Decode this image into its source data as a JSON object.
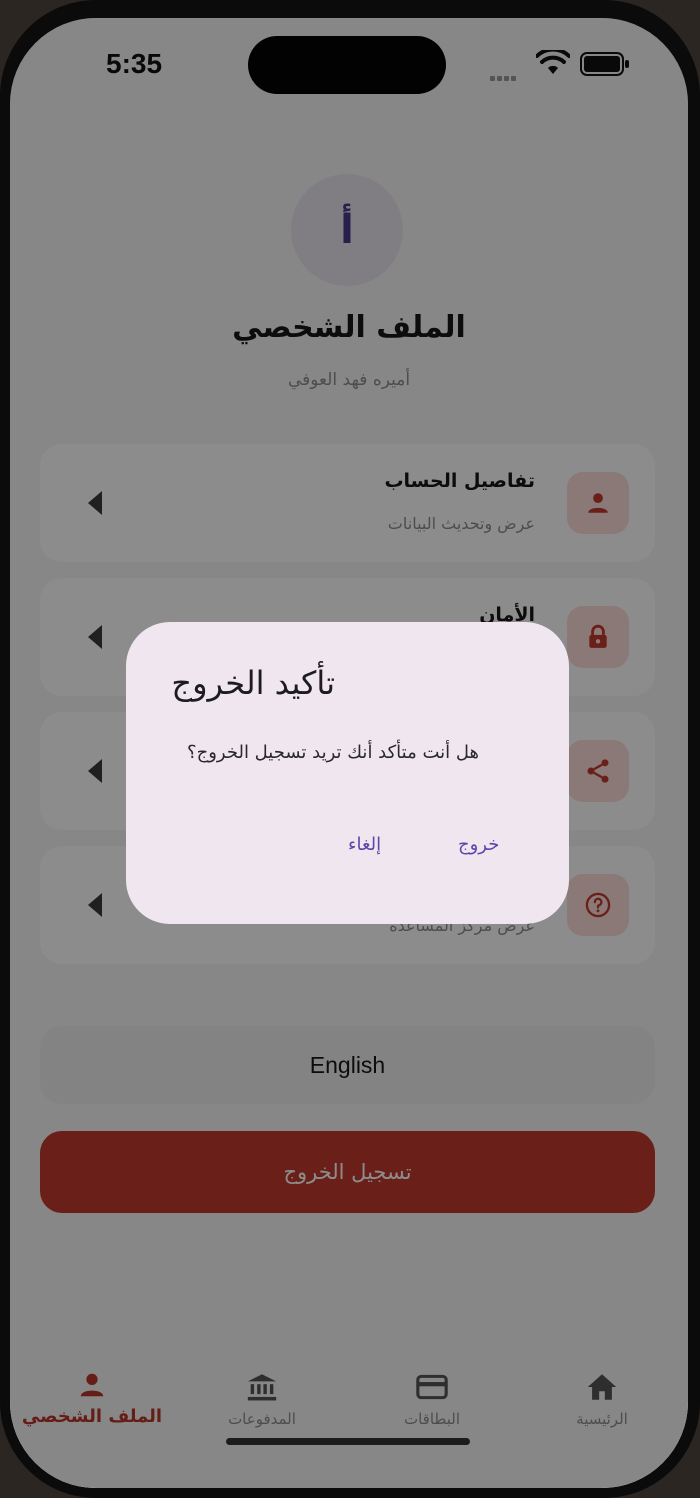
{
  "status_bar": {
    "time": "5:35"
  },
  "profile": {
    "avatar_initial": "أ",
    "title": "الملف الشخصي",
    "name": "أميره فهد العوفي"
  },
  "menu": {
    "account": {
      "title": "تفاصيل الحساب",
      "subtitle": "عرض وتحديث البيانات",
      "icon": "person-icon"
    },
    "security": {
      "title": "الأمان",
      "subtitle": "",
      "icon": "lock-icon"
    },
    "share": {
      "title": "",
      "subtitle": "",
      "icon": "share-icon"
    },
    "help": {
      "title": "",
      "subtitle": "عرض مركز المساعدة",
      "icon": "help-icon"
    }
  },
  "language_button": "English",
  "logout_button": "تسجيل الخروج",
  "tabs": [
    {
      "label": "الملف الشخصي",
      "icon": "person-icon",
      "active": true
    },
    {
      "label": "المدفوعات",
      "icon": "bank-icon",
      "active": false
    },
    {
      "label": "البطاقات",
      "icon": "card-icon",
      "active": false
    },
    {
      "label": "الرئيسية",
      "icon": "home-icon",
      "active": false
    }
  ],
  "dialog": {
    "title": "تأكيد الخروج",
    "message": "هل أنت متأكد أنك تريد تسجيل الخروج؟",
    "confirm": "خروج",
    "cancel": "إلغاء"
  },
  "colors": {
    "accent": "#c23b2e",
    "icon_tint_bg": "#fbdcd8",
    "dialog_bg": "#efe6f0",
    "dialog_button": "#5b47a8"
  }
}
